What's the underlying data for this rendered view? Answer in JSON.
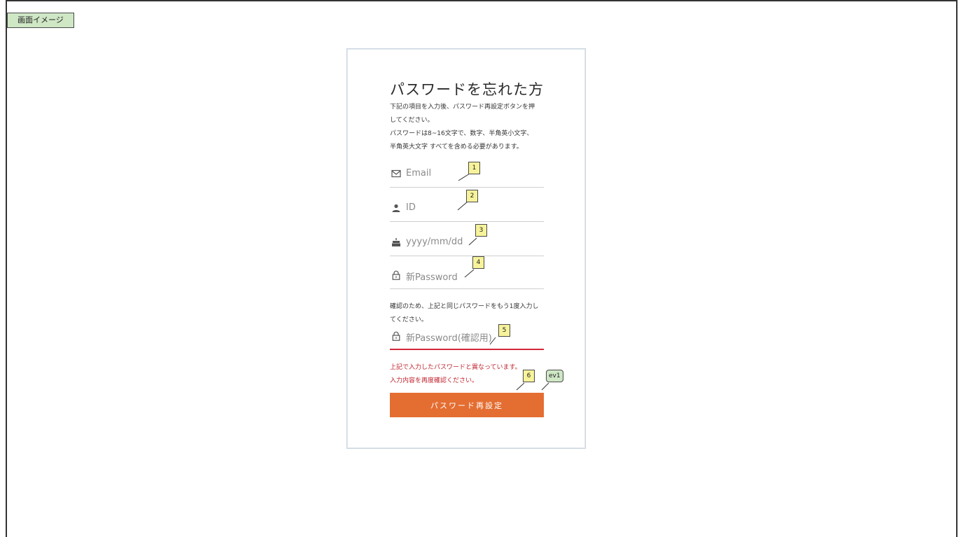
{
  "doc_tag": "画面イメージ",
  "form": {
    "title": "パスワードを忘れた方",
    "description": [
      "下記の項目を入力後、パスワード再設定ボタンを押",
      "してください。",
      "パスワードは8~16文字で、数字、半角英小文字、",
      "半角英大文字 すべてを含める必要があります。"
    ],
    "fields": {
      "email": {
        "placeholder": "Email",
        "icon": "mail-icon"
      },
      "id": {
        "placeholder": "ID",
        "icon": "user-icon"
      },
      "birthday": {
        "placeholder": "yyyy/mm/dd",
        "icon": "cake-icon"
      },
      "new_password": {
        "placeholder": "新Password",
        "icon": "lock-icon"
      },
      "confirm_password": {
        "placeholder": "新Password(確認用)",
        "icon": "lock-icon"
      }
    },
    "confirm_note": [
      "確認のため、上記と同じパスワードをもう1度入力し",
      "てください。"
    ],
    "error_message": [
      "上記で入力したパスワードと異なっています。",
      "入力内容を再度確認ください。"
    ],
    "submit_label": "パスワード再設定",
    "accent_color": "#e46d31",
    "error_color": "#c0242f"
  },
  "callouts": [
    "1",
    "2",
    "3",
    "4",
    "5",
    "6",
    "ev1"
  ]
}
